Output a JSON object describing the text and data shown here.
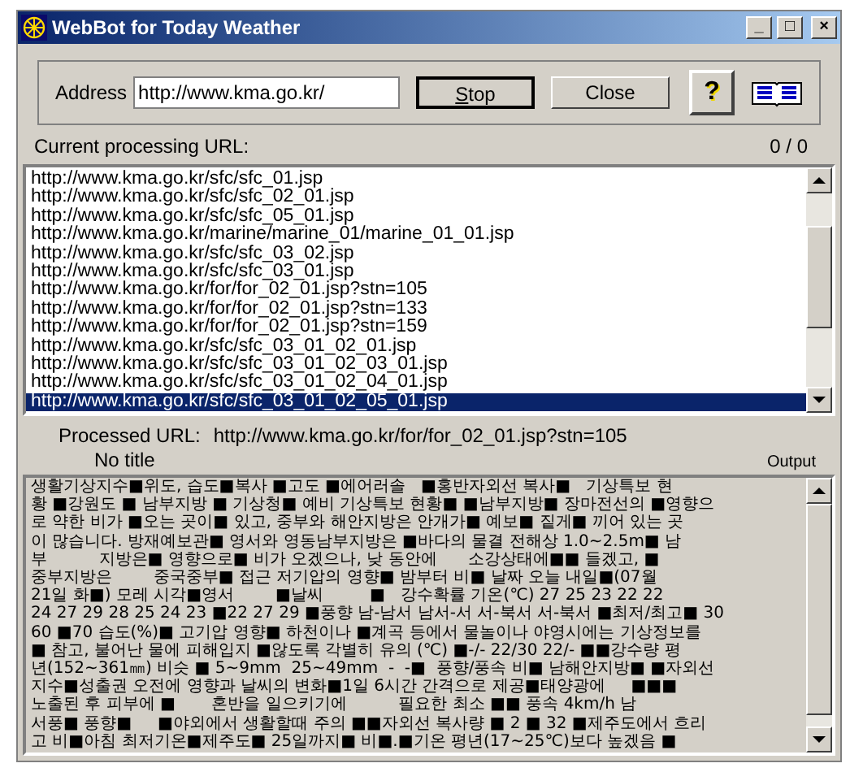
{
  "window": {
    "title": "WebBot for Today Weather",
    "controls": [
      "_",
      "□",
      "×"
    ]
  },
  "address": {
    "label": "Address",
    "value": "http://www.kma.go.kr/"
  },
  "buttons": [
    {
      "kind": "text",
      "label": "Stop",
      "underline_first": true,
      "default": true
    },
    {
      "kind": "text",
      "label": "Close",
      "default": false
    },
    {
      "kind": "help",
      "label": "?"
    },
    {
      "kind": "book"
    }
  ],
  "current": {
    "label": "Current processing URL:",
    "count": "0 / 0"
  },
  "urls": [
    {
      "text": "http://www.kma.go.kr/sfc/sfc_01.jsp",
      "selected": false
    },
    {
      "text": "http://www.kma.go.kr/sfc/sfc_02_01.jsp",
      "selected": false
    },
    {
      "text": "http://www.kma.go.kr/sfc/sfc_05_01.jsp",
      "selected": false
    },
    {
      "text": "http://www.kma.go.kr/marine/marine_01/marine_01_01.jsp",
      "selected": false
    },
    {
      "text": "http://www.kma.go.kr/sfc/sfc_03_02.jsp",
      "selected": false
    },
    {
      "text": "http://www.kma.go.kr/sfc/sfc_03_01.jsp",
      "selected": false
    },
    {
      "text": "http://www.kma.go.kr/for/for_02_01.jsp?stn=105",
      "selected": false
    },
    {
      "text": "http://www.kma.go.kr/for/for_02_01.jsp?stn=133",
      "selected": false
    },
    {
      "text": "http://www.kma.go.kr/for/for_02_01.jsp?stn=159",
      "selected": false
    },
    {
      "text": "http://www.kma.go.kr/sfc/sfc_03_01_02_01.jsp",
      "selected": false
    },
    {
      "text": "http://www.kma.go.kr/sfc/sfc_03_01_02_03_01.jsp",
      "selected": false
    },
    {
      "text": "http://www.kma.go.kr/sfc/sfc_03_01_02_04_01.jsp",
      "selected": false
    },
    {
      "text": "http://www.kma.go.kr/sfc/sfc_03_01_02_05_01.jsp",
      "selected": true
    }
  ],
  "processed": {
    "label": "Processed URL:",
    "url": "http://www.kma.go.kr/for/for_02_01.jsp?stn=105",
    "title": "No title"
  },
  "output": {
    "label": "Output",
    "lines": [
      "생활기상지수■위도, 습도■복사 ■고도 ■에어러솔   ■홍반자외선 복사■   기상특보 현",
      "황 ■강원도 ■ 남부지방 ■ 기상청■ 예비 기상특보 현황■ ■남부지방■ 장마전선의 ■영향으",
      "로 약한 비가 ■오는 곳이■ 있고, 중부와 해안지방은 안개가■ 예보■ 짙게■ 끼어 있는 곳",
      "이 많습니다. 방재예보관■ 영서와 영동남부지방은 ■바다의 물결 전해상 1.0~2.5m■ 남",
      "부          지방은■ 영향으로■ 비가 오겠으나, 낮 동안에      소강상태에■■ 들겠고, ■",
      "중부지방은        중국중부■ 접근 저기압의 영향■ 밤부터 비■ 날짜 오늘 내일■(07월",
      "21일 화■) 모레 시각■영서        ■날씨         ■   강수확률 기온(℃) 27 25 23 22 22",
      "24 27 29 28 25 24 23 ■22 27 29 ■풍향 남-남서 남서-서 서-북서 서-북서 ■최저/최고■ 30",
      "60 ■70 습도(%)■ 고기압 영향■ 하천이나 ■계곡 등에서 물놀이나 야영시에는 기상정보를",
      "■ 참고, 불어난 물에 피해입지 ■않도록 각별히 유의 (℃) ■-/- 22/30 22/- ■■강수량 평",
      "년(152~361㎜) 비슷 ■ 5~9mm  25~49mm  -  -■  풍향/풍속 비■ 남해안지방■ ■자외선",
      "지수■성출권 오전에 영향과 날씨의 변화■1일 6시간 간격으로 제공■태양광에     ■■■",
      "노출된 후 피부에 ■       혼반을 일으키기에          필요한 최소 ■■ 풍속 4km/h 남",
      "서풍■ 풍향■     ■야외에서 생활할때 주의 ■■자외선 복사량 ■ 2 ■ 32 ■제주도에서 흐리",
      "고 비■아침 최저기온■제주도■ 25일까지■ 비■.■기온 평년(17~25℃)보다 높겠음 ■"
    ]
  }
}
